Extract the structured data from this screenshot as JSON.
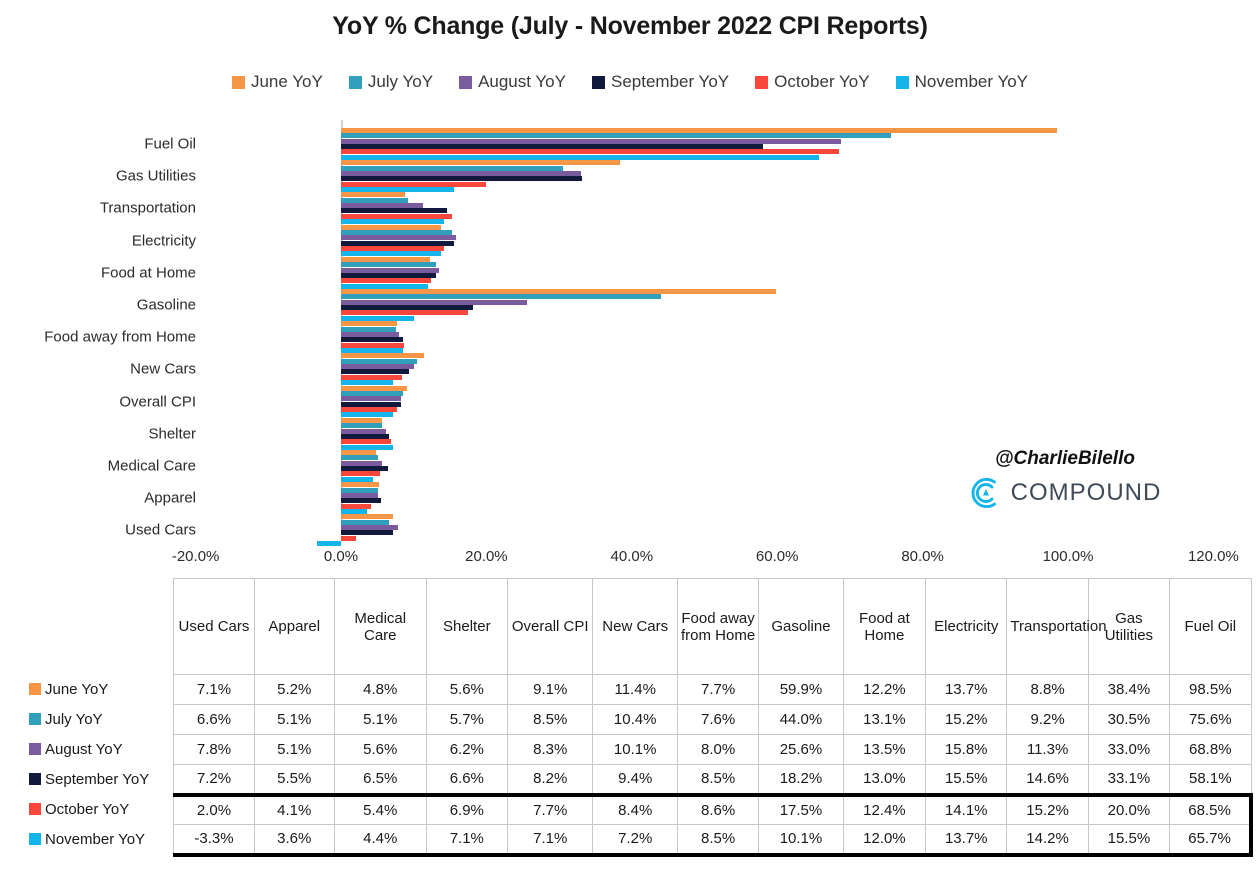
{
  "chart_title": "YoY % Change (July - November 2022 CPI Reports)",
  "watermark": {
    "handle": "@CharlieBilello",
    "brand": "COMPOUND",
    "logo_icon": "compound-logo-icon"
  },
  "legend": {
    "items": [
      {
        "label": "June YoY",
        "color": "#F79646"
      },
      {
        "label": "July YoY",
        "color": "#31A0BC"
      },
      {
        "label": "August YoY",
        "color": "#7A5C9E"
      },
      {
        "label": "September YoY",
        "color": "#111A3C"
      },
      {
        "label": "October YoY",
        "color": "#F9483B"
      },
      {
        "label": "November YoY",
        "color": "#13B5EA"
      }
    ]
  },
  "x_axis": {
    "ticks": [
      "-20.0%",
      "0.0%",
      "20.0%",
      "40.0%",
      "60.0%",
      "80.0%",
      "100.0%",
      "120.0%"
    ],
    "tick_values": [
      -20,
      0,
      20,
      40,
      60,
      80,
      100,
      120
    ]
  },
  "chart_categories_top_down": [
    "Fuel Oil",
    "Gas Utilities",
    "Transportation",
    "Electricity",
    "Food at Home",
    "Gasoline",
    "Food away from Home",
    "New Cars",
    "Overall CPI",
    "Shelter",
    "Medical Care",
    "Apparel",
    "Used Cars"
  ],
  "table": {
    "corner_label": "",
    "columns": [
      "Used Cars",
      "Apparel",
      "Medical Care",
      "Shelter",
      "Overall CPI",
      "New Cars",
      "Food away from Home",
      "Gasoline",
      "Food at Home",
      "Electricity",
      "Transportation",
      "Gas Utilities",
      "Fuel Oil"
    ],
    "rows": [
      {
        "label": "June YoY",
        "color": "#F79646",
        "values": [
          "7.1%",
          "5.2%",
          "4.8%",
          "5.6%",
          "9.1%",
          "11.4%",
          "7.7%",
          "59.9%",
          "12.2%",
          "13.7%",
          "8.8%",
          "38.4%",
          "98.5%"
        ]
      },
      {
        "label": "July YoY",
        "color": "#31A0BC",
        "values": [
          "6.6%",
          "5.1%",
          "5.1%",
          "5.7%",
          "8.5%",
          "10.4%",
          "7.6%",
          "44.0%",
          "13.1%",
          "15.2%",
          "9.2%",
          "30.5%",
          "75.6%"
        ]
      },
      {
        "label": "August YoY",
        "color": "#7A5C9E",
        "values": [
          "7.8%",
          "5.1%",
          "5.6%",
          "6.2%",
          "8.3%",
          "10.1%",
          "8.0%",
          "25.6%",
          "13.5%",
          "15.8%",
          "11.3%",
          "33.0%",
          "68.8%"
        ]
      },
      {
        "label": "September YoY",
        "color": "#111A3C",
        "values": [
          "7.2%",
          "5.5%",
          "6.5%",
          "6.6%",
          "8.2%",
          "9.4%",
          "8.5%",
          "18.2%",
          "13.0%",
          "15.5%",
          "14.6%",
          "33.1%",
          "58.1%"
        ]
      },
      {
        "label": "October YoY",
        "color": "#F9483B",
        "highlighted": true,
        "values": [
          "2.0%",
          "4.1%",
          "5.4%",
          "6.9%",
          "7.7%",
          "8.4%",
          "8.6%",
          "17.5%",
          "12.4%",
          "14.1%",
          "15.2%",
          "20.0%",
          "68.5%"
        ]
      },
      {
        "label": "November YoY",
        "color": "#13B5EA",
        "highlighted": true,
        "values": [
          "-3.3%",
          "3.6%",
          "4.4%",
          "7.1%",
          "7.1%",
          "7.2%",
          "8.5%",
          "10.1%",
          "12.0%",
          "13.7%",
          "14.2%",
          "15.5%",
          "65.7%"
        ]
      }
    ]
  },
  "chart_data": {
    "type": "bar",
    "orientation": "horizontal",
    "title": "YoY % Change (July - November 2022 CPI Reports)",
    "xlabel": "",
    "ylabel": "",
    "xlim": [
      -20,
      120
    ],
    "grid": false,
    "legend_position": "top",
    "categories": [
      "Fuel Oil",
      "Gas Utilities",
      "Transportation",
      "Electricity",
      "Food at Home",
      "Gasoline",
      "Food away from Home",
      "New Cars",
      "Overall CPI",
      "Shelter",
      "Medical Care",
      "Apparel",
      "Used Cars"
    ],
    "series": [
      {
        "name": "June YoY",
        "color": "#F79646",
        "values": [
          98.5,
          38.4,
          8.8,
          13.7,
          12.2,
          59.9,
          7.7,
          11.4,
          9.1,
          5.6,
          4.8,
          5.2,
          7.1
        ]
      },
      {
        "name": "July YoY",
        "color": "#31A0BC",
        "values": [
          75.6,
          30.5,
          9.2,
          15.2,
          13.1,
          44.0,
          7.6,
          10.4,
          8.5,
          5.7,
          5.1,
          5.1,
          6.6
        ]
      },
      {
        "name": "August YoY",
        "color": "#7A5C9E",
        "values": [
          68.8,
          33.0,
          11.3,
          15.8,
          13.5,
          25.6,
          8.0,
          10.1,
          8.3,
          6.2,
          5.6,
          5.1,
          7.8
        ]
      },
      {
        "name": "September YoY",
        "color": "#111A3C",
        "values": [
          58.1,
          33.1,
          14.6,
          15.5,
          13.0,
          18.2,
          8.5,
          9.4,
          8.2,
          6.6,
          6.5,
          5.5,
          7.2
        ]
      },
      {
        "name": "October YoY",
        "color": "#F9483B",
        "values": [
          68.5,
          20.0,
          15.2,
          14.1,
          12.4,
          17.5,
          8.6,
          8.4,
          7.7,
          6.9,
          5.4,
          4.1,
          2.0
        ]
      },
      {
        "name": "November YoY",
        "color": "#13B5EA",
        "values": [
          65.7,
          15.5,
          14.2,
          13.7,
          12.0,
          10.1,
          8.5,
          7.2,
          7.1,
          7.1,
          4.4,
          3.6,
          -3.3
        ]
      }
    ]
  }
}
